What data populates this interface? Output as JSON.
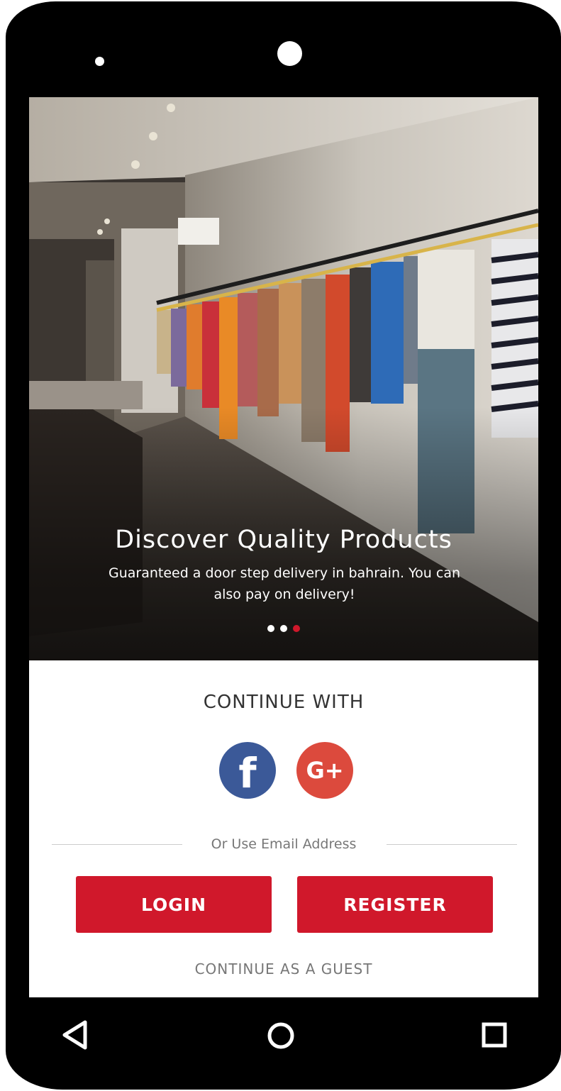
{
  "hero": {
    "image_description": "clothing-store-interior",
    "title": "Discover Quality Products",
    "subtitle": "Guaranteed a door step delivery in bahrain. You can also pay on delivery!",
    "carousel": {
      "total_slides": 3,
      "active_index": 3
    }
  },
  "auth": {
    "continue_with_label": "CONTINUE WITH",
    "facebook_icon": "f",
    "google_icon": "G+",
    "or_email_label": "Or Use Email Address",
    "login_label": "LOGIN",
    "register_label": "REGISTER",
    "guest_label": "CONTINUE AS A GUEST"
  },
  "colors": {
    "accent": "#d0182b",
    "facebook": "#3b5998",
    "google": "#dc4a3d"
  },
  "nav_bar": {
    "icons": [
      "back-icon",
      "home-icon",
      "recent-apps-icon"
    ]
  }
}
